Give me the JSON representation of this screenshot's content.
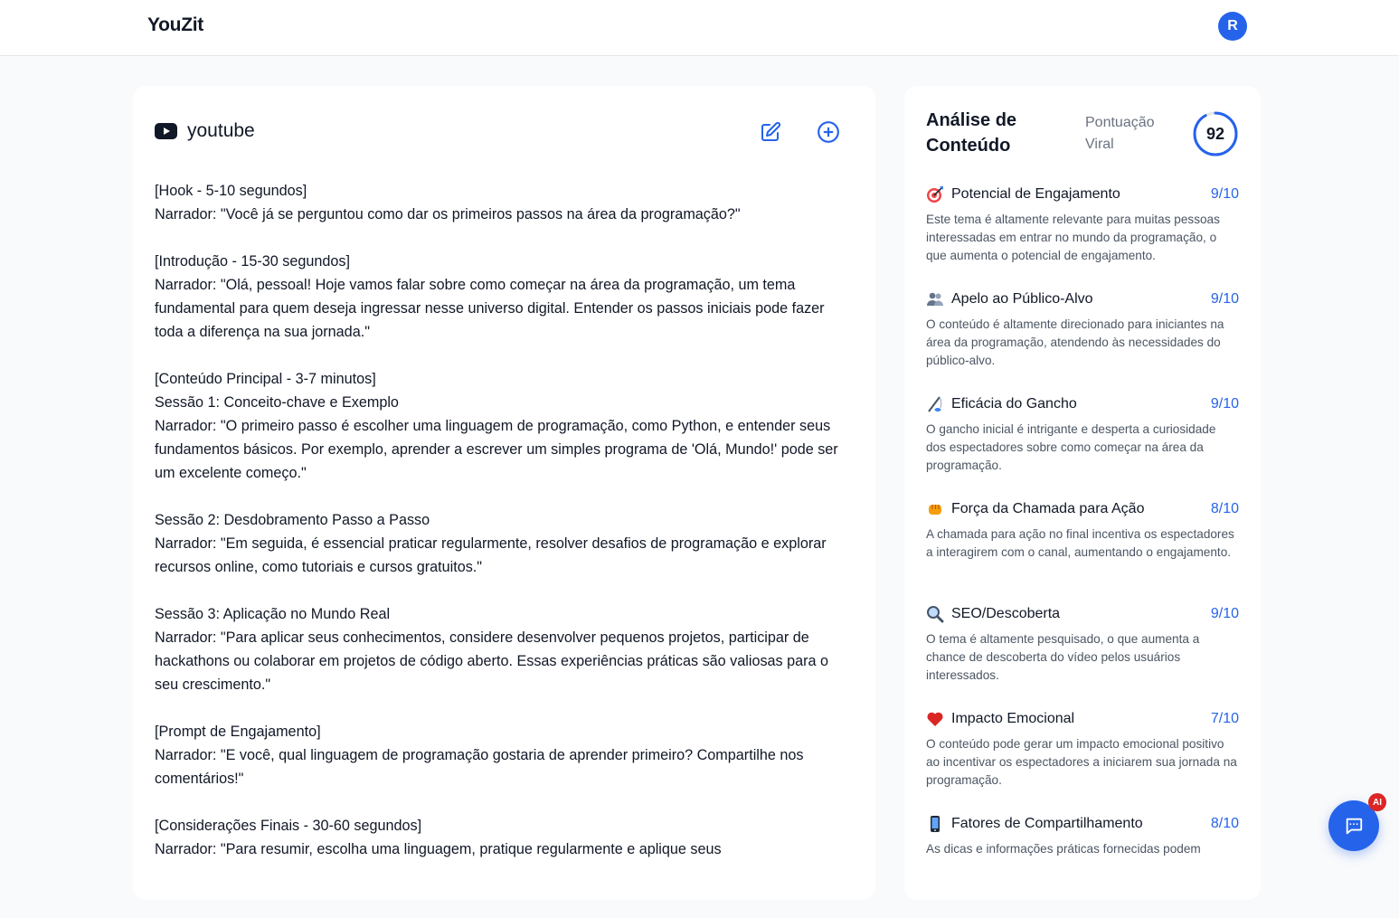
{
  "header": {
    "brand": "YouZit",
    "avatar_initial": "R"
  },
  "script": {
    "platform": "youtube",
    "platform_icon": "youtube-icon",
    "lines": [
      "[Hook - 5-10 segundos]",
      "Narrador: \"Você já se perguntou como dar os primeiros passos na área da programação?\"",
      "",
      "[Introdução - 15-30 segundos]",
      "Narrador: \"Olá, pessoal! Hoje vamos falar sobre como começar na área da programação, um tema fundamental para quem deseja ingressar nesse universo digital. Entender os passos iniciais pode fazer toda a diferença na sua jornada.\"",
      "",
      "[Conteúdo Principal - 3-7 minutos]",
      "Sessão 1: Conceito-chave e Exemplo",
      "Narrador: \"O primeiro passo é escolher uma linguagem de programação, como Python, e entender seus fundamentos básicos. Por exemplo, aprender a escrever um simples programa de 'Olá, Mundo!' pode ser um excelente começo.\"",
      "",
      "Sessão 2: Desdobramento Passo a Passo",
      "Narrador: \"Em seguida, é essencial praticar regularmente, resolver desafios de programação e explorar recursos online, como tutoriais e cursos gratuitos.\"",
      "",
      "Sessão 3: Aplicação no Mundo Real",
      "Narrador: \"Para aplicar seus conhecimentos, considere desenvolver pequenos projetos, participar de hackathons ou colaborar em projetos de código aberto. Essas experiências práticas são valiosas para o seu crescimento.\"",
      "",
      "[Prompt de Engajamento]",
      "Narrador: \"E você, qual linguagem de programação gostaria de aprender primeiro? Compartilhe nos comentários!\"",
      "",
      "[Considerações Finais - 30-60 segundos]",
      "Narrador: \"Para resumir, escolha uma linguagem, pratique regularmente e aplique seus"
    ]
  },
  "analysis": {
    "title": "Análise de Conteúdo",
    "viral_label": "Pontuação Viral",
    "viral_score": "92",
    "viral_fraction": 0.92,
    "metrics": [
      {
        "icon": "target-icon",
        "name": "Potencial de Engajamento",
        "score": "9/10",
        "desc": "Este tema é altamente relevante para muitas pessoas interessadas em entrar no mundo da programação, o que aumenta o potencial de engajamento."
      },
      {
        "icon": "people-icon",
        "name": "Apelo ao Público-Alvo",
        "score": "9/10",
        "desc": "O conteúdo é altamente direcionado para iniciantes na área da programação, atendendo às necessidades do público-alvo."
      },
      {
        "icon": "fishing-pole-icon",
        "name": "Eficácia do Gancho",
        "score": "9/10",
        "desc": "O gancho inicial é intrigante e desperta a curiosidade dos espectadores sobre como começar na área da programação."
      },
      {
        "icon": "fist-icon",
        "name": "Força da Chamada para Ação",
        "score": "8/10",
        "desc": "A chamada para ação no final incentiva os espectadores a interagirem com o canal, aumentando o engajamento."
      },
      {
        "icon": "magnifier-icon",
        "name": "SEO/Descoberta",
        "score": "9/10",
        "desc": "O tema é altamente pesquisado, o que aumenta a chance de descoberta do vídeo pelos usuários interessados."
      },
      {
        "icon": "heart-icon",
        "name": "Impacto Emocional",
        "score": "7/10",
        "desc": "O conteúdo pode gerar um impacto emocional positivo ao incentivar os espectadores a iniciarem sua jornada na programação."
      },
      {
        "icon": "phone-icon",
        "name": "Fatores de Compartilhamento",
        "score": "8/10",
        "desc": "As dicas e informações práticas fornecidas podem"
      }
    ]
  },
  "chat": {
    "badge": "AI",
    "icon": "chat-icon"
  },
  "colors": {
    "accent": "#2563eb",
    "badge": "#dc2626",
    "ring_track": "#e5e7eb"
  }
}
